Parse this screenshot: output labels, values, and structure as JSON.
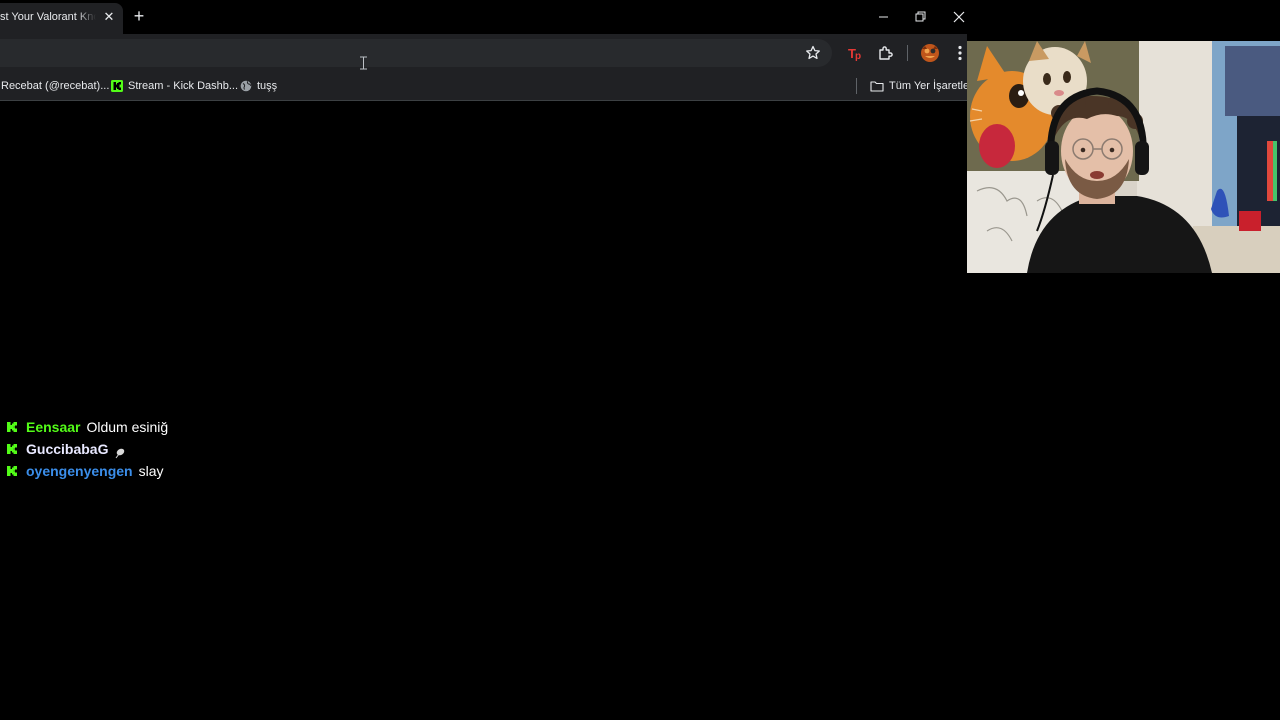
{
  "browser": {
    "tab": {
      "title": "st Your Valorant Knowl",
      "close_glyph": "✕"
    },
    "new_tab_glyph": "+",
    "window_controls": [
      "minimize",
      "restore",
      "close"
    ],
    "omnibox": {
      "value": "",
      "placeholder": ""
    },
    "toolbar_icons": [
      "star-icon",
      "extension-tp-icon",
      "puzzle-icon",
      "profile-avatar",
      "more-menu-icon"
    ],
    "bookmarks": [
      {
        "label": "Recebat (@recebat)...",
        "icon": "none"
      },
      {
        "label": "Stream - Kick Dashb...",
        "icon": "kick-logo-icon"
      },
      {
        "label": "tuşş",
        "icon": "globe-icon"
      }
    ],
    "all_bookmarks_label": "Tüm Yer İşaretleri"
  },
  "chat": {
    "messages": [
      {
        "username": "Eensaar",
        "text": "Oldum esiniğ",
        "color": "#53fc18"
      },
      {
        "username": "GuccibabaG",
        "text": "",
        "color": "#e8e8ff",
        "emote": "leaf-emote"
      },
      {
        "username": "oyengenyengen",
        "text": "slay",
        "color": "#3b8eea"
      }
    ],
    "badge_color": "#53fc18"
  },
  "colors": {
    "chrome_bg": "#202124",
    "page_bg": "#000000",
    "kick_green": "#53fc18"
  }
}
